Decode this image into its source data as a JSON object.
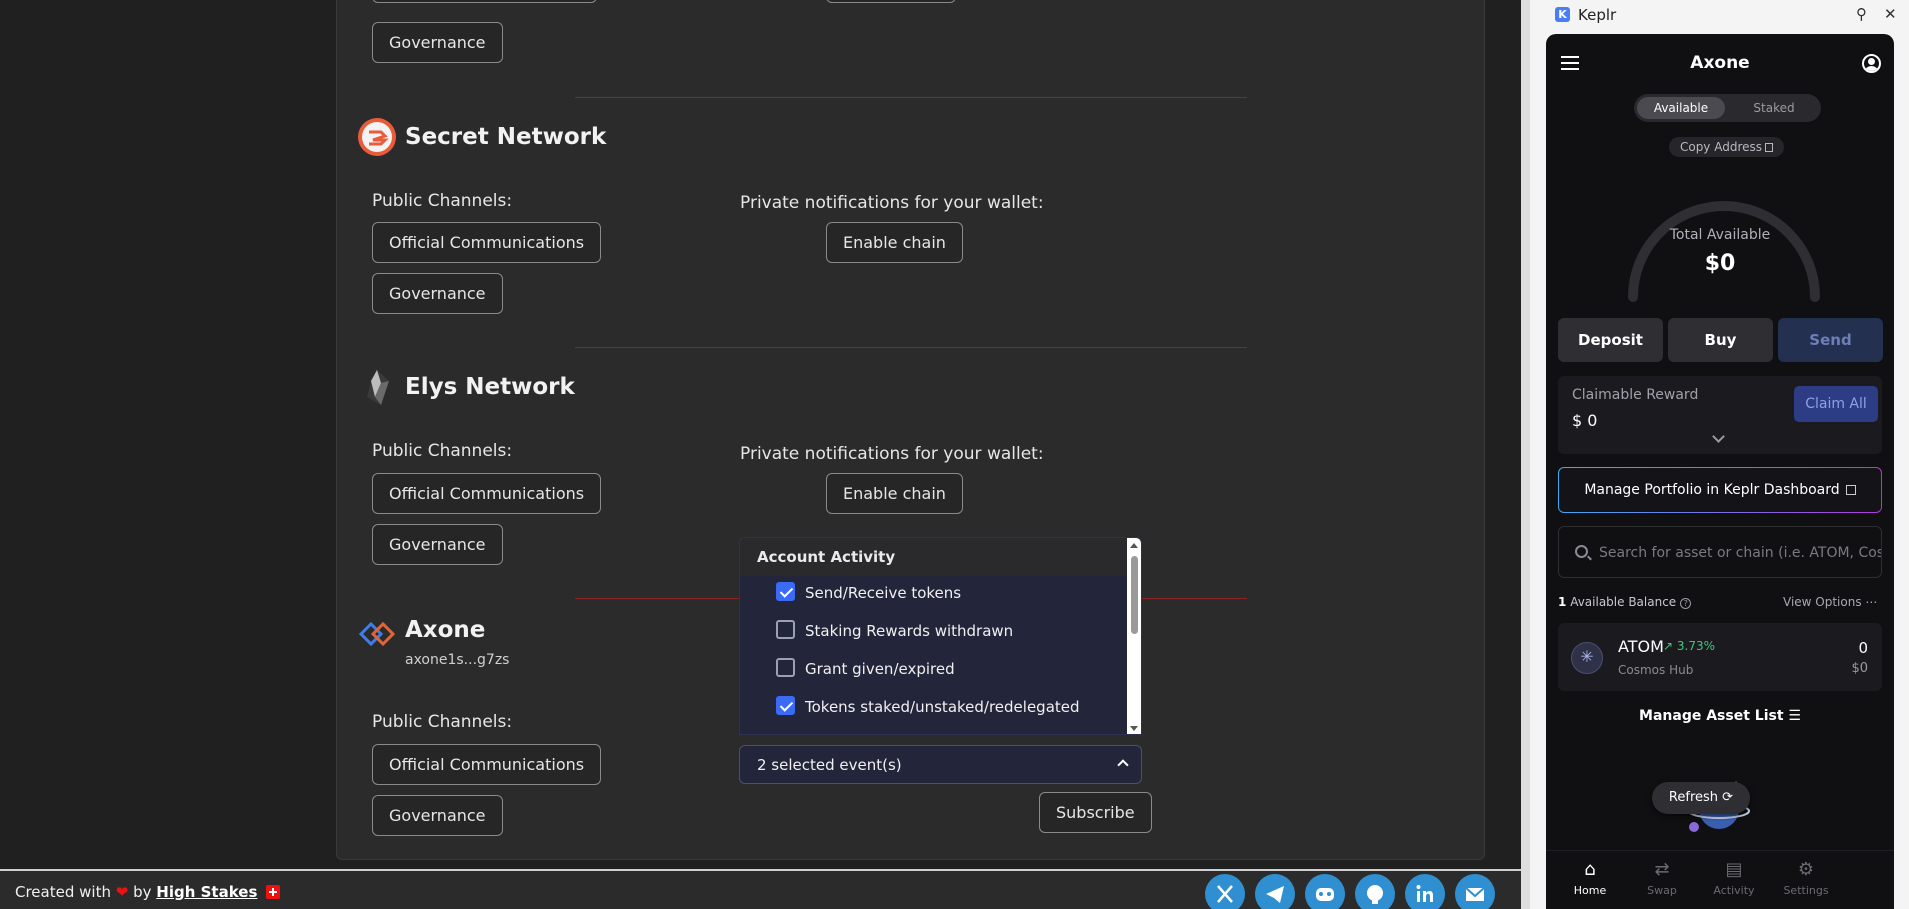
{
  "networks": [
    {
      "name": "Secret Network",
      "public_label": "Public Channels:",
      "channels": [
        "Official Communications",
        "Governance"
      ],
      "private_label": "Private notifications for your wallet:",
      "enable_label": "Enable chain"
    },
    {
      "name": "Elys Network",
      "public_label": "Public Channels:",
      "channels": [
        "Official Communications",
        "Governance"
      ],
      "private_label": "Private notifications for your wallet:",
      "enable_label": "Enable chain"
    },
    {
      "name": "Axone",
      "address": "axone1s...g7zs",
      "public_label": "Public Channels:",
      "channels": [
        "Official Communications",
        "Governance"
      ]
    }
  ],
  "top_partial": {
    "governance_label": "Governance"
  },
  "activity": {
    "header": "Account Activity",
    "items": [
      {
        "label": "Send/Receive tokens",
        "checked": true
      },
      {
        "label": "Staking Rewards withdrawn",
        "checked": false
      },
      {
        "label": "Grant given/expired",
        "checked": false
      },
      {
        "label": "Tokens staked/unstaked/redelegated",
        "checked": true
      }
    ],
    "selected_summary": "2 selected event(s)",
    "subscribe_label": "Subscribe"
  },
  "footer": {
    "text_prefix": "Created with",
    "heart": "❤",
    "text_by": "by",
    "link": "High Stakes",
    "socials": [
      "x-icon",
      "telegram-icon",
      "discord-icon",
      "github-icon",
      "linkedin-icon",
      "email-icon"
    ]
  },
  "keplr": {
    "window_title": "Keplr",
    "logo_letter": "K",
    "chain": "Axone",
    "tabs": [
      "Available",
      "Staked"
    ],
    "copy_address": "Copy Address",
    "total_label": "Total Available",
    "total_value": "$0",
    "buttons": {
      "deposit": "Deposit",
      "buy": "Buy",
      "send": "Send"
    },
    "reward": {
      "label": "Claimable Reward",
      "value": "$ 0",
      "claim": "Claim All"
    },
    "dashboard": "Manage Portfolio in Keplr Dashboard",
    "search_placeholder": "Search for asset or chain (i.e. ATOM, Cosmos)",
    "balance_count": "1",
    "balance_label": "Available Balance",
    "view_options": "View Options",
    "asset": {
      "symbol": "ATOM",
      "change": "3.73%",
      "network": "Cosmos Hub",
      "amount": "0",
      "value": "$0"
    },
    "manage_assets": "Manage Asset List",
    "refresh": "Refresh",
    "nav": [
      "Home",
      "Swap",
      "Activity",
      "Settings"
    ]
  },
  "colors": {
    "accent_blue": "#3b6bf5",
    "separator_red": "#8b2424",
    "keplr_blue": "#4a7cf6"
  }
}
